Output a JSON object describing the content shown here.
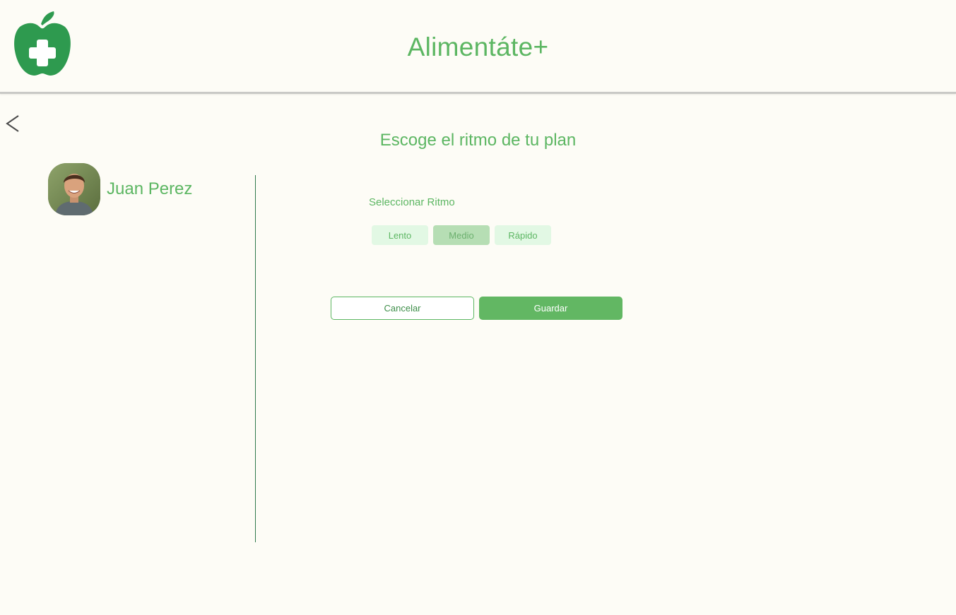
{
  "header": {
    "app_title": "Alimentáte+",
    "logo_icon": "apple-plus-icon"
  },
  "navigation": {
    "back_icon": "chevron-left-icon"
  },
  "page": {
    "title": "Escoge el ritmo de tu plan"
  },
  "profile": {
    "name": "Juan Perez",
    "avatar_icon": "user-avatar"
  },
  "rhythm": {
    "label": "Seleccionar Ritmo",
    "options": [
      "Lento",
      "Medio",
      "Rápido"
    ],
    "selected": "Medio"
  },
  "actions": {
    "cancel_label": "Cancelar",
    "save_label": "Guardar"
  },
  "colors": {
    "brand_green": "#5cb662",
    "logo_green": "#2e9a4f",
    "option_bg": "#e2f8e4",
    "option_selected_bg": "#b6deb4",
    "background": "#fdfcf6",
    "divider": "#2f7a4c"
  }
}
